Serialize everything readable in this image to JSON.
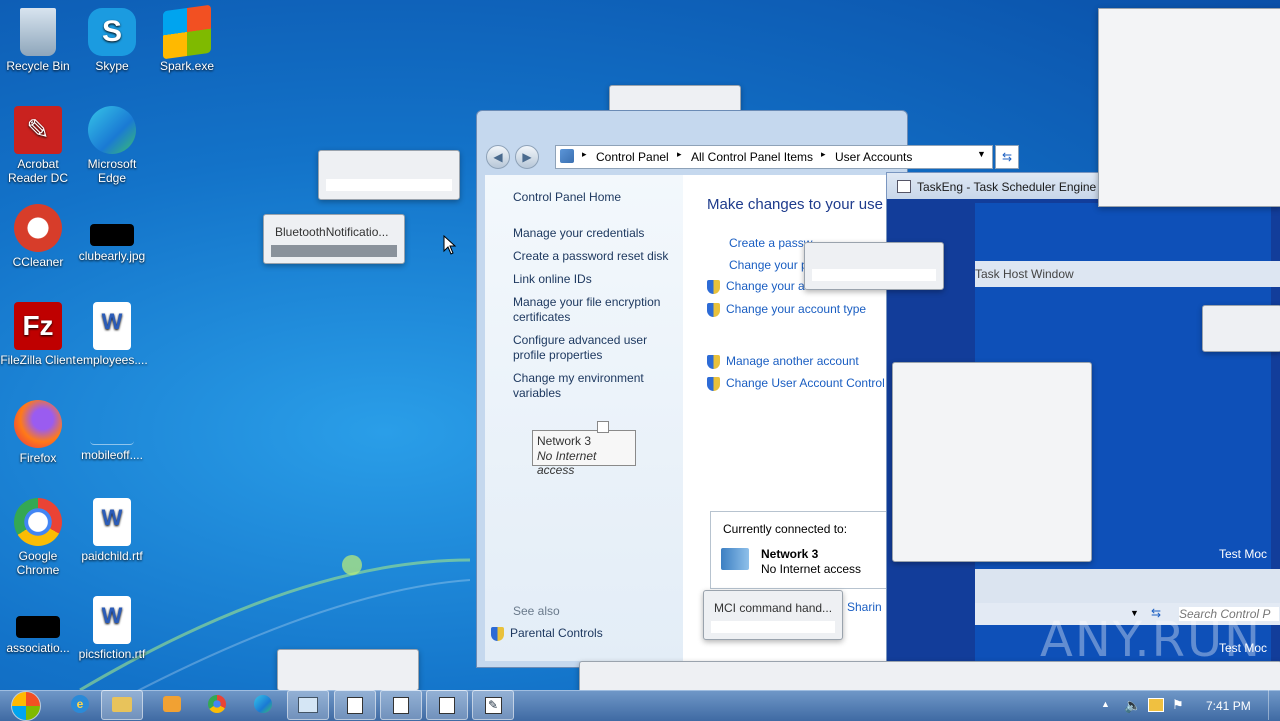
{
  "desktop": {
    "icons": [
      {
        "label": "Recycle Bin",
        "icon": "recycle-bin-icon"
      },
      {
        "label": "Skype",
        "icon": "skype-icon"
      },
      {
        "label": "Spark.exe",
        "icon": "windows-flag-icon"
      },
      {
        "label": "Acrobat Reader DC",
        "icon": "acrobat-icon"
      },
      {
        "label": "Microsoft Edge",
        "icon": "edge-icon"
      },
      {
        "label": "CCleaner",
        "icon": "ccleaner-icon"
      },
      {
        "label": "clubearly.jpg",
        "icon": "image-file-icon"
      },
      {
        "label": "FileZilla Client",
        "icon": "filezilla-icon"
      },
      {
        "label": "employees....",
        "icon": "word-doc-icon"
      },
      {
        "label": "Firefox",
        "icon": "firefox-icon"
      },
      {
        "label": "mobileoff....",
        "icon": "blank-file-icon"
      },
      {
        "label": "Google Chrome",
        "icon": "chrome-icon"
      },
      {
        "label": "paidchild.rtf",
        "icon": "word-doc-icon"
      },
      {
        "label": "associatio...",
        "icon": "image-file-icon"
      },
      {
        "label": "picsfiction.rtf",
        "icon": "word-doc-icon"
      }
    ]
  },
  "popups": {
    "bluetooth": "BluetoothNotificatio...",
    "network_name": "Network  3",
    "network_status": "No Internet access",
    "mci": "MCI command hand..."
  },
  "control_panel": {
    "breadcrumb": [
      "Control Panel",
      "All Control Panel Items",
      "User Accounts"
    ],
    "search_placeholder": "Search Cont",
    "left_links": [
      "Control Panel Home",
      "Manage your credentials",
      "Create a password reset disk",
      "Link online IDs",
      "Manage your file encryption certificates",
      "Configure advanced user profile properties",
      "Change my environment variables"
    ],
    "see_also": "See also",
    "parental_controls": "Parental Controls",
    "heading": "Make changes to your use",
    "main_links": [
      "Create a passw",
      "Change your p",
      "Change your a",
      "Change your account type",
      "Manage another account",
      "Change User Account Control"
    ],
    "connected_label": "Currently connected to:",
    "network_name": "Network  3",
    "network_status": "No Internet access",
    "sharing_fragment": "d Sharin"
  },
  "taskeng": {
    "title": "TaskEng - Task Scheduler Engine P",
    "task_host": "Task Host Window",
    "test_mode_1": "Test Moc",
    "test_mode_2": "Test Moc",
    "search_placeholder": "Search Control P"
  },
  "watermark": "ANY.RUN",
  "taskbar": {
    "clock": "7:41 PM",
    "buttons": [
      "ie-icon",
      "explorer-icon",
      "media-player-icon",
      "chrome-icon",
      "edge-icon",
      "control-panel-icon",
      "window-icon",
      "window-icon",
      "window-icon",
      "notepad-icon"
    ]
  }
}
